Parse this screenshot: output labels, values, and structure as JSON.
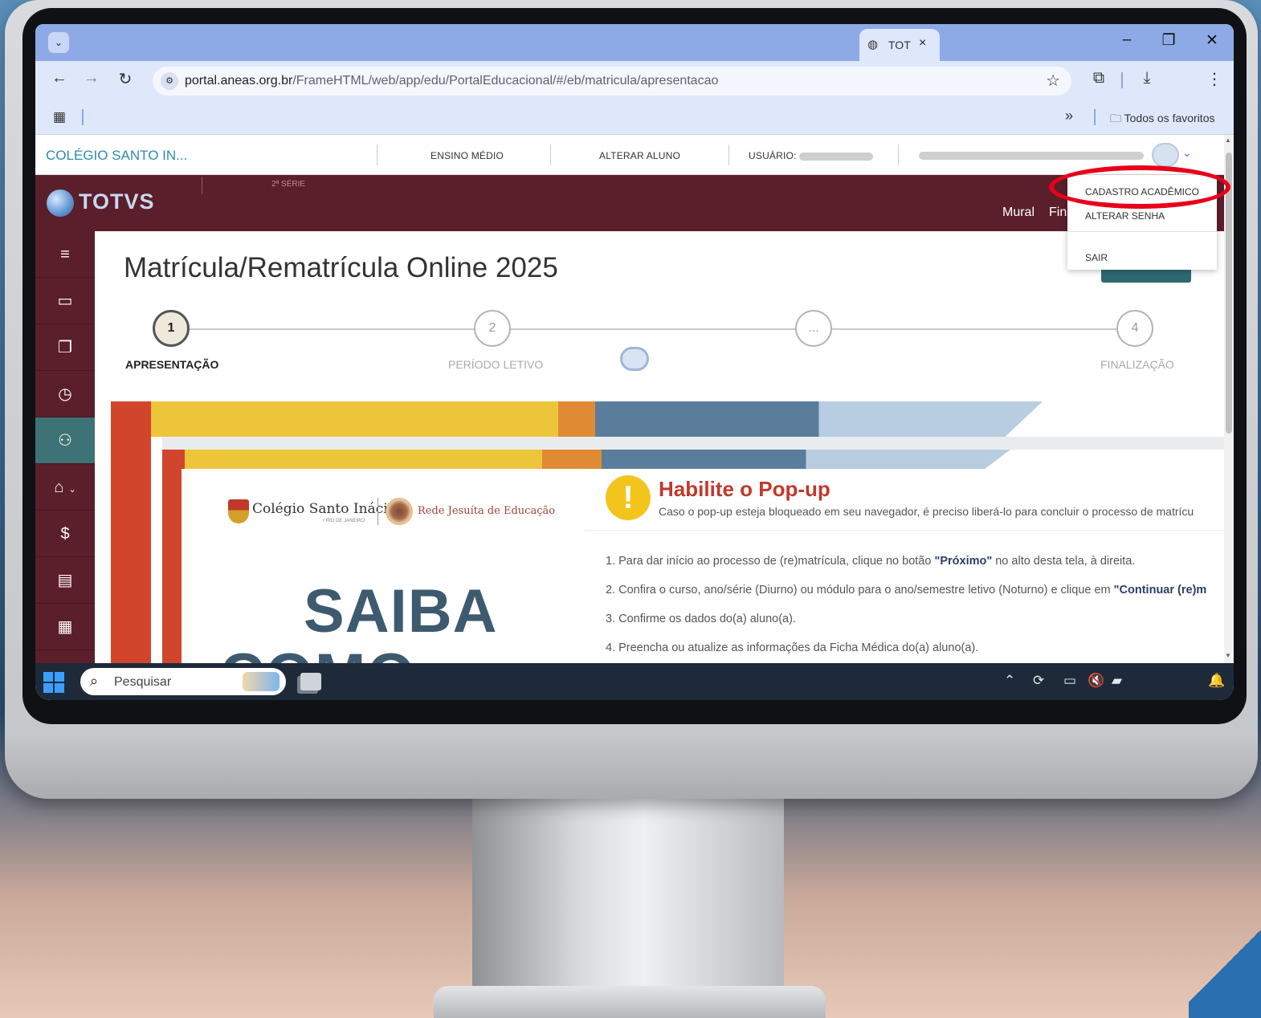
{
  "browser": {
    "tab_list_icon": "chevron-down-icon",
    "tab_title": "TOT",
    "tab_close": "×",
    "window_controls": {
      "minimize": "–",
      "restore": "❐",
      "close": "✕"
    },
    "nav": {
      "back": "←",
      "forward": "→",
      "reload": "↻"
    },
    "url_host": "portal.aneas.org.br",
    "url_path": "/FrameHTML/web/app/edu/PortalEducacional/#/eb/matricula/apresentacao",
    "bookmark_star": "☆",
    "bookmarks_more": "»",
    "bookmarks_folder": "Todos os favoritos"
  },
  "portal_top": {
    "school": "COLÉGIO SANTO IN...",
    "level": "ENSINO MÉDIO",
    "change_student": "ALTERAR ALUNO",
    "user_label": "USUÁRIO:"
  },
  "header": {
    "brand": "TOTVS",
    "grade": "2ª SÉRIE",
    "links": [
      "Mural",
      "Fin"
    ]
  },
  "user_menu": {
    "items": [
      "CADASTRO ACADÊMICO",
      "ALTERAR SENHA",
      "SAIR"
    ],
    "highlight_color": "#e8001a"
  },
  "sidebar": {
    "items": [
      {
        "icon": "menu-icon",
        "glyph": "≡"
      },
      {
        "icon": "monitor-icon",
        "glyph": "▭"
      },
      {
        "icon": "documents-icon",
        "glyph": "❐"
      },
      {
        "icon": "clock-icon",
        "glyph": "◷"
      },
      {
        "icon": "user-check-icon",
        "glyph": "⚇"
      },
      {
        "icon": "graduation-cap-icon",
        "glyph": "⌂"
      },
      {
        "icon": "dollar-icon",
        "glyph": "$"
      },
      {
        "icon": "file-icon",
        "glyph": "▤"
      },
      {
        "icon": "layout-icon",
        "glyph": "▦"
      }
    ],
    "active_index": 4,
    "active_color": "#3d7377"
  },
  "main": {
    "title": "Matrícula/Rematrícula Online 2025",
    "steps": [
      {
        "number": "1",
        "label": "APRESENTAÇÃO",
        "active": true
      },
      {
        "number": "2",
        "label": "PERÍODO LETIVO",
        "active": false
      },
      {
        "number": "...",
        "label": "",
        "active": false
      },
      {
        "number": "4",
        "label": "FINALIZAÇÃO",
        "active": false
      }
    ]
  },
  "banner": {
    "school_logo_text": "Colégio Santo Inácio",
    "school_logo_sub": "• RIO DE JANEIRO",
    "network": "Rede Jesuíta de Educação",
    "headline_1": "SAIBA",
    "headline_2": "COMO FAZER",
    "popup_title": "Habilite o Pop-up",
    "popup_sub": "Caso o pop-up esteja bloqueado em seu navegador, é preciso liberá-lo para concluir o processo de matrícu",
    "instructions": [
      {
        "pre": "1. Para dar início ao processo de (re)matrícula, clique no botão ",
        "bold": "\"Próximo\"",
        "post": " no alto desta tela, à direita."
      },
      {
        "pre": "2. Confira o curso, ano/série (Diurno) ou módulo para o ano/semestre letivo (Noturno) e clique em ",
        "bold": "\"Continuar (re)m",
        "post": ""
      },
      {
        "pre": "3. Confirme os dados do(a) aluno(a).",
        "bold": "",
        "post": ""
      },
      {
        "pre": "4. Preencha ou atualize as informações da Ficha Médica do(a) aluno(a).",
        "bold": "",
        "post": ""
      }
    ],
    "colors": {
      "yellow": "#ecc53a",
      "red": "#d2452d",
      "orange": "#e08a34",
      "blue": "#5b7d9c",
      "light_blue": "#b9cde0",
      "text_blue": "#3e5a6f",
      "title_red": "#c0392b"
    }
  },
  "taskbar": {
    "search_placeholder": "Pesquisar",
    "tray_icons": [
      "chevron-up-icon",
      "sync-icon",
      "display-icon",
      "speaker-muted-icon",
      "folder-icon",
      "bell-icon"
    ]
  }
}
